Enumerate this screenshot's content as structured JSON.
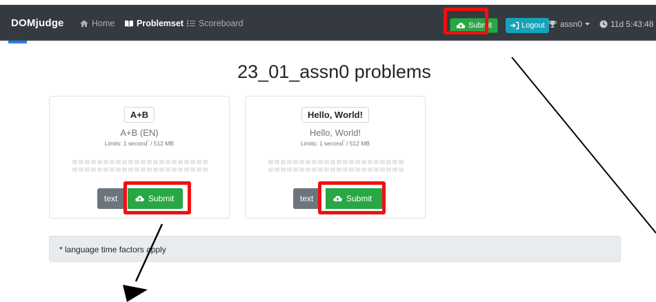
{
  "navbar": {
    "brand": "DOMjudge",
    "home_label": "Home",
    "problemset_label": "Problemset",
    "scoreboard_label": "Scoreboard",
    "submit_label": "Submit",
    "logout_label": "Logout",
    "user_label": "assn0",
    "time_label": "11d 5:43:48",
    "home_icon": "home-icon",
    "problemset_icon": "book-icon",
    "scoreboard_icon": "list-icon",
    "submit_icon": "cloud-upload-icon",
    "logout_icon": "sign-out-icon",
    "user_icon": "trophy-icon",
    "time_icon": "clock-icon"
  },
  "page": {
    "title": "23_01_assn0 problems"
  },
  "problems": [
    {
      "badge": "A+B",
      "name": "A+B (EN)",
      "limits": "Limits: 1 second",
      "limits_sup": "*",
      "limits_mem": " / 512 MB",
      "text_button": "text",
      "submit_button": "Submit"
    },
    {
      "badge": "Hello, World!",
      "name": "Hello, World!",
      "limits": "Limits: 1 second",
      "limits_sup": "*",
      "limits_mem": " / 512 MB",
      "text_button": "text",
      "submit_button": "Submit"
    }
  ],
  "footnote": "* language time factors apply",
  "colors": {
    "navbar_bg": "#343a40",
    "success": "#28a745",
    "info": "#17a2b8",
    "secondary": "#6c757d",
    "highlight": "#ee1111"
  }
}
